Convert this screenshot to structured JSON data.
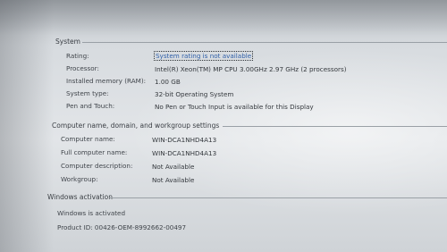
{
  "system": {
    "section_title": "System",
    "rating_label": "Rating:",
    "rating_value": "System rating is not available",
    "processor_label": "Processor:",
    "processor_value": "Intel(R) Xeon(TM) MP CPU 3.00GHz   2.97 GHz  (2 processors)",
    "memory_label": "Installed memory (RAM):",
    "memory_value": "1.00 GB",
    "type_label": "System type:",
    "type_value": "32-bit Operating System",
    "pen_label": "Pen and Touch:",
    "pen_value": "No Pen or Touch Input is available for this Display"
  },
  "computer": {
    "section_title": "Computer name, domain, and workgroup settings",
    "name_label": "Computer name:",
    "name_value": "WIN-DCA1NHD4A13",
    "full_name_label": "Full computer name:",
    "full_name_value": "WIN-DCA1NHD4A13",
    "description_label": "Computer description:",
    "description_value": "Not Available",
    "workgroup_label": "Workgroup:",
    "workgroup_value": "Not Available"
  },
  "activation": {
    "section_title": "Windows activation",
    "status": "Windows is activated",
    "product_id": "Product ID:  00426-OEM-8992662-00497"
  }
}
